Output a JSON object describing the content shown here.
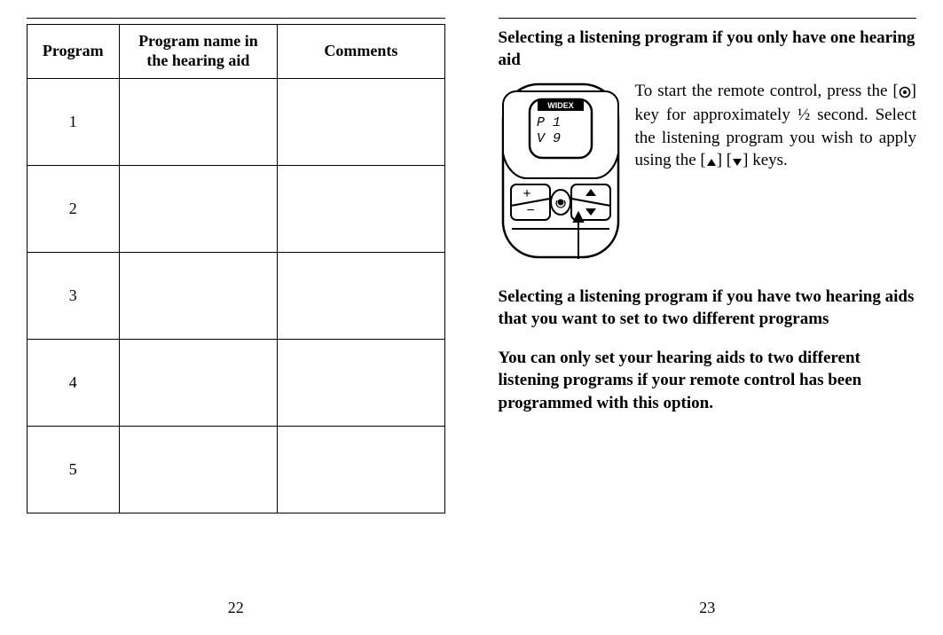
{
  "left": {
    "headers": {
      "program": "Program",
      "program_name": "Program name in the hearing aid",
      "comments": "Comments"
    },
    "rows": [
      {
        "num": "1",
        "name": "",
        "comments": ""
      },
      {
        "num": "2",
        "name": "",
        "comments": ""
      },
      {
        "num": "3",
        "name": "",
        "comments": ""
      },
      {
        "num": "4",
        "name": "",
        "comments": ""
      },
      {
        "num": "5",
        "name": "",
        "comments": ""
      }
    ],
    "page_number": "22"
  },
  "right": {
    "heading1": "Selecting a listening program if you only have one hearing aid",
    "intro_pre": "To start the remote control, press the [",
    "intro_mid1": "] key for approximately ½ second. Select the listening program you wish to apply using the [",
    "intro_mid2": "] [",
    "intro_post": "] keys.",
    "heading2": "Selecting a listening program if you have two hearing aids that you want to set to two different programs",
    "bold_note": "You can only set your hearing aids to two different listening programs if your remote control has been programmed with this option.",
    "page_number": "23",
    "remote": {
      "brand": "WIDEX",
      "display_line1": "P   1",
      "display_line2": "V   9"
    }
  }
}
